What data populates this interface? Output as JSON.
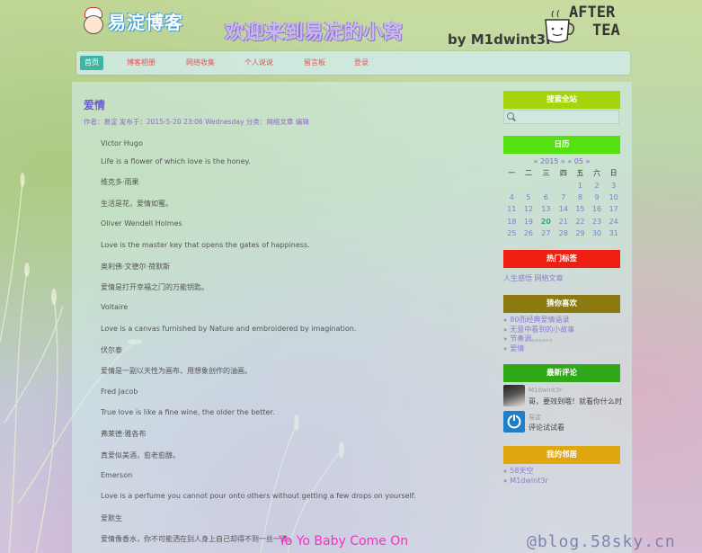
{
  "header": {
    "logo_text": "易淀博客",
    "welcome": "欢迎来到易淀的小窝",
    "author": "by M1dwint3r",
    "after_tea": [
      "AFTER",
      "TEA"
    ]
  },
  "nav": [
    {
      "label": "首页",
      "active": true
    },
    {
      "label": "博客相册",
      "active": false
    },
    {
      "label": "网络收集",
      "active": false
    },
    {
      "label": "个人说说",
      "active": false
    },
    {
      "label": "留言板",
      "active": false
    },
    {
      "label": "登录",
      "active": false
    }
  ],
  "post": {
    "title": "爱情",
    "meta": "作者：易淀  发布于：2015-5-20 23:06 Wednesday  分类：网络文章  编辑",
    "lines": [
      "Victor Hugo",
      "Life is a flower of which love is the honey.",
      "维克多·雨果",
      "生活是花，爱情如蜜。",
      "Oliver Wendell Holmes",
      "Love is the master key that opens the gates of happiness.",
      "奥利佛·文德尔·荷默斯",
      "爱情是打开幸福之门的万能钥匙。",
      "Voltaire",
      "Love is a canvas furnished by Nature and embroidered by imagination.",
      "伏尔泰",
      "爱情是一副以天性为画布、用想象创作的油画。",
      "Fred Jacob",
      "True love is like a fine wine, the older the better.",
      "弗莱德·雅各布",
      "真爱似美酒，愈老愈醇。",
      "Emerson",
      "Love is a perfume you cannot pour onto others without getting a few drops on yourself.",
      "爱默生",
      "爱情像香水，你不可能洒在别人身上自己却得不到一丝一滴。"
    ]
  },
  "sidebar": {
    "search_title": "搜索全站",
    "search_placeholder": "",
    "calendar": {
      "title": "日历",
      "nav": "« 2015 » « 05 »",
      "weekdays": [
        "一",
        "二",
        "三",
        "四",
        "五",
        "六",
        "日"
      ],
      "weeks": [
        [
          "",
          "",
          "",
          "",
          "1",
          "2",
          "3"
        ],
        [
          "4",
          "5",
          "6",
          "7",
          "8",
          "9",
          "10"
        ],
        [
          "11",
          "12",
          "13",
          "14",
          "15",
          "16",
          "17"
        ],
        [
          "18",
          "19",
          "20",
          "21",
          "22",
          "23",
          "24"
        ],
        [
          "25",
          "26",
          "27",
          "28",
          "29",
          "30",
          "31"
        ]
      ],
      "today": "20"
    },
    "hot_tags_title": "热门标签",
    "hot_tags": "人生感悟  网络文章",
    "guess_title": "猜你喜欢",
    "guess_items": [
      "80而经典爱情语录",
      "无意中看到的小故事",
      "节奏调。。。。。。",
      "爱情"
    ],
    "recent_title": "最新评论",
    "comments": [
      {
        "name": "M1dwint3r",
        "text": "哥，要效到哦！就看你什么时"
      },
      {
        "name": "易淀",
        "text": "评论试试看"
      }
    ],
    "neighbors_title": "我的邻居",
    "neighbors": [
      "58天空",
      "M1dwint3r"
    ]
  },
  "footer": {
    "lyric": "Yo Yo Baby Come On",
    "watermark": "@blog.58sky.cn"
  },
  "colors": {
    "search_head": "#a4d40c",
    "calendar_head": "#55e010",
    "tags_head": "#ee1e10",
    "guess_head": "#8c7a10",
    "recent_head": "#2fa81a",
    "neighbors_head": "#e0a810"
  }
}
